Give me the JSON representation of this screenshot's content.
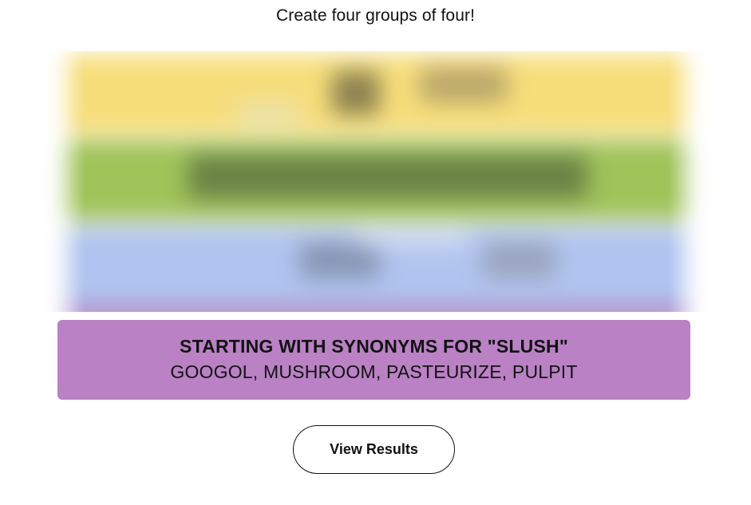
{
  "instructions": "Create four groups of four!",
  "solved_group": {
    "title": "STARTING WITH SYNONYMS FOR \"SLUSH\"",
    "members": "GOOGOL, MUSHROOM, PASTEURIZE, PULPIT",
    "color": "#ba81c5"
  },
  "blurred_groups": {
    "colors": [
      "#f7de7b",
      "#a0c35a",
      "#b0c4ef"
    ]
  },
  "results_button": {
    "label": "View Results"
  }
}
